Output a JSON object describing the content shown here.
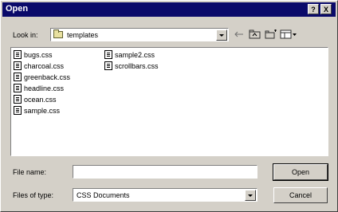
{
  "window": {
    "title": "Open",
    "help_label": "?",
    "close_label": "X"
  },
  "look_in": {
    "label": "Look in:",
    "value": "templates"
  },
  "toolbar": {
    "back_icon": "back-arrow-icon",
    "up_icon": "up-folder-icon",
    "new_folder_icon": "new-folder-icon",
    "view_icon": "view-menu-icon"
  },
  "files": {
    "col1": [
      "bugs.css",
      "charcoal.css",
      "greenback.css",
      "headline.css",
      "ocean.css",
      "sample.css"
    ],
    "col2": [
      "sample2.css",
      "scrollbars.css"
    ]
  },
  "file_name": {
    "label": "File name:",
    "value": ""
  },
  "file_type": {
    "label": "Files of type:",
    "value": "CSS Documents"
  },
  "buttons": {
    "open": "Open",
    "cancel": "Cancel"
  },
  "colors": {
    "titlebar": "#0a0a6a",
    "face": "#d4d0c8"
  }
}
